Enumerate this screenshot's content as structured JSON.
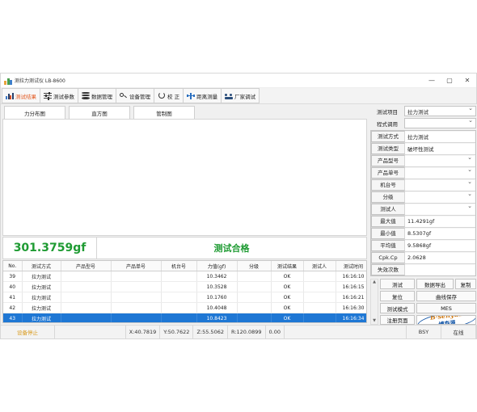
{
  "window": {
    "title": "测拉力测试仪 LB-8600",
    "app_icon": "bar-chart-icon",
    "minimize": "—",
    "maximize": "▢",
    "close": "✕"
  },
  "toolbar": {
    "buttons": [
      {
        "label": "测试结果",
        "icon": "bar-chart-icon",
        "active": true
      },
      {
        "label": "测试参数",
        "icon": "sliders-icon",
        "active": false
      },
      {
        "label": "数据管理",
        "icon": "database-icon",
        "active": false
      },
      {
        "label": "设备管理",
        "icon": "gear-icon",
        "active": false
      },
      {
        "label": "校  正",
        "icon": "refresh-icon",
        "active": false
      },
      {
        "label": "距离测量",
        "icon": "measure-icon",
        "active": false
      },
      {
        "label": "厂家调试",
        "icon": "wrench-icon",
        "active": false
      }
    ]
  },
  "tabs": [
    {
      "label": "力分布图",
      "selected": true
    },
    {
      "label": "直方图",
      "selected": false
    },
    {
      "label": "管制图",
      "selected": false
    }
  ],
  "readout": {
    "force_value": "301.3759gf",
    "status_text": "测试合格",
    "status_color": "#1f9b33"
  },
  "table": {
    "columns": [
      "No.",
      "测试方式",
      "产品型号",
      "产品单号",
      "机台号",
      "力值(gf)",
      "分级",
      "测试结果",
      "测试人",
      "测试时间"
    ],
    "rows": [
      {
        "no": "39",
        "method": "拉力测试",
        "model": "",
        "order": "",
        "machine": "",
        "force": "10.3462",
        "grade": "",
        "result": "OK",
        "operator": "",
        "time": "16:16:10",
        "selected": false
      },
      {
        "no": "40",
        "method": "拉力测试",
        "model": "",
        "order": "",
        "machine": "",
        "force": "10.3528",
        "grade": "",
        "result": "OK",
        "operator": "",
        "time": "16:16:15",
        "selected": false
      },
      {
        "no": "41",
        "method": "拉力测试",
        "model": "",
        "order": "",
        "machine": "",
        "force": "10.1760",
        "grade": "",
        "result": "OK",
        "operator": "",
        "time": "16:16:21",
        "selected": false
      },
      {
        "no": "42",
        "method": "拉力测试",
        "model": "",
        "order": "",
        "machine": "",
        "force": "10.4048",
        "grade": "",
        "result": "OK",
        "operator": "",
        "time": "16:16:30",
        "selected": false
      },
      {
        "no": "43",
        "method": "拉力测试",
        "model": "",
        "order": "",
        "machine": "",
        "force": "10.8423",
        "grade": "",
        "result": "OK",
        "operator": "",
        "time": "16:16:34",
        "selected": true
      }
    ]
  },
  "right_panel": {
    "test_item": {
      "label": "测试项目",
      "value": "拉力测试"
    },
    "program_call": {
      "label": "程式调用",
      "value": ""
    },
    "fields": [
      {
        "label": "测试方式",
        "value": "拉力测试",
        "combo": false
      },
      {
        "label": "测试类型",
        "value": "破坏性测试",
        "combo": false
      },
      {
        "label": "产品型号",
        "value": "",
        "combo": true
      },
      {
        "label": "产品单号",
        "value": "",
        "combo": true
      },
      {
        "label": "机台号",
        "value": "",
        "combo": true
      },
      {
        "label": "分级",
        "value": "",
        "combo": true
      },
      {
        "label": "测试人",
        "value": "",
        "combo": true
      },
      {
        "label": "最大值",
        "value": "11.4291gf",
        "combo": false
      },
      {
        "label": "最小值",
        "value": "8.5307gf",
        "combo": false
      },
      {
        "label": "平均值",
        "value": "9.5868gf",
        "combo": false
      },
      {
        "label": "Cpk.Cp",
        "value": "2.0628",
        "combo": false
      },
      {
        "label": "失效次数",
        "value": "",
        "combo": false
      }
    ],
    "buttons": {
      "test": "测试",
      "data_export": "数据导出",
      "copy": "复制",
      "reset": "复位",
      "curve_save": "曲线保存",
      "test_mode": "测试模式",
      "mes": "MES",
      "register_page": "注册页面"
    },
    "logo": {
      "top": "B·senyuan",
      "bottom": "博森源"
    }
  },
  "statusbar": {
    "device_state": "设备停止",
    "x": "X:40.7819",
    "y": "Y:50.7622",
    "z": "Z:55.5062",
    "r": "R:120.0899",
    "extra": "0.00",
    "bsy": "BSY",
    "online": "在线"
  }
}
